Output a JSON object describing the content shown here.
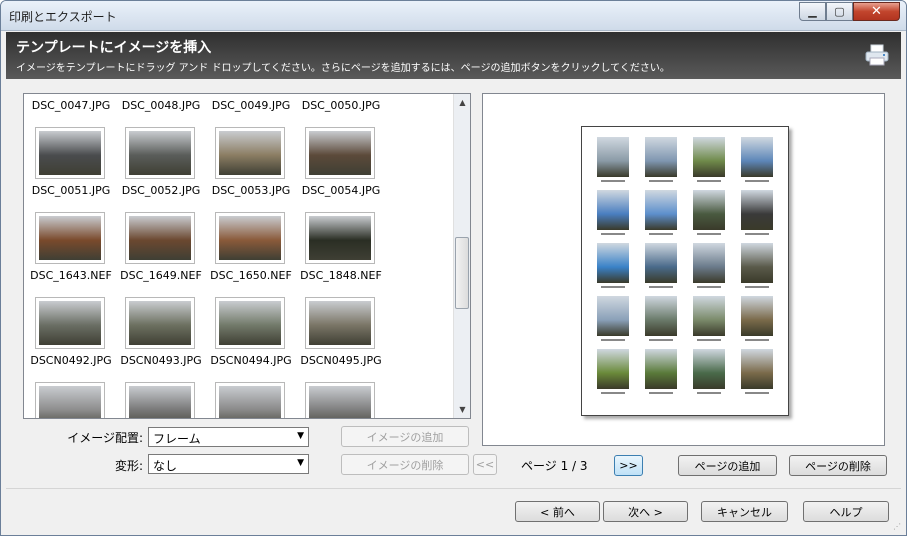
{
  "window": {
    "title": "印刷とエクスポート"
  },
  "header": {
    "title": "テンプレートにイメージを挿入",
    "subtitle": "イメージをテンプレートにドラッグ アンド ドロップしてください。さらにページを追加するには、ページの追加ボタンをクリックしてください。"
  },
  "thumbnails": [
    {
      "name": "DSC_0047.JPG",
      "color": "#6d6e62"
    },
    {
      "name": "DSC_0048.JPG",
      "color": "#7a7c72"
    },
    {
      "name": "DSC_0049.JPG",
      "color": "#8a8a6a"
    },
    {
      "name": "DSC_0050.JPG",
      "color": "#6f7a4c"
    },
    {
      "name": "DSC_0051.JPG",
      "color": "#4a4c4e"
    },
    {
      "name": "DSC_0052.JPG",
      "color": "#5a5d5a"
    },
    {
      "name": "DSC_0053.JPG",
      "color": "#8b7d63"
    },
    {
      "name": "DSC_0054.JPG",
      "color": "#5c4a3a"
    },
    {
      "name": "DSC_1643.NEF",
      "color": "#7a4a2c"
    },
    {
      "name": "DSC_1649.NEF",
      "color": "#6b4830"
    },
    {
      "name": "DSC_1650.NEF",
      "color": "#8a5a3a"
    },
    {
      "name": "DSC_1848.NEF",
      "color": "#2a2e24"
    },
    {
      "name": "DSCN0492.JPG",
      "color": "#6a6e64"
    },
    {
      "name": "DSCN0493.JPG",
      "color": "#6c7060"
    },
    {
      "name": "DSCN0494.JPG",
      "color": "#727a6a"
    },
    {
      "name": "DSCN0495.JPG",
      "color": "#7a7566"
    },
    {
      "name": "",
      "color": "#8c8c8c"
    },
    {
      "name": "",
      "color": "#777777"
    },
    {
      "name": "",
      "color": "#888888"
    },
    {
      "name": "",
      "color": "#7d7d7d"
    }
  ],
  "controls": {
    "layout_label": "イメージ配置:",
    "layout_value": "フレーム",
    "transform_label": "変形:",
    "transform_value": "なし",
    "add_image": "イメージの追加",
    "remove_image": "イメージの削除",
    "prev_page": "<<",
    "page_text": "ページ 1 / 3",
    "next_page": ">>",
    "add_page": "ページの追加",
    "delete_page": "ページの削除"
  },
  "footer": {
    "back": "< 前へ",
    "next": "次へ >",
    "cancel": "キャンセル",
    "help": "ヘルプ"
  },
  "preview_colors": [
    "#8a9aa6",
    "#7f96b0",
    "#6f8a4a",
    "#5d86b8",
    "#4a7ec0",
    "#5d8fcc",
    "#4a5a40",
    "#3a3a3a",
    "#3a82c8",
    "#4a6a8a",
    "#6a7a8a",
    "#5a5a4a",
    "#8aa0b8",
    "#6a7a6a",
    "#7a8a6a",
    "#7a6a4a",
    "#6a8a3a",
    "#5a7a3a",
    "#4a6a4a",
    "#7a6a4a"
  ]
}
